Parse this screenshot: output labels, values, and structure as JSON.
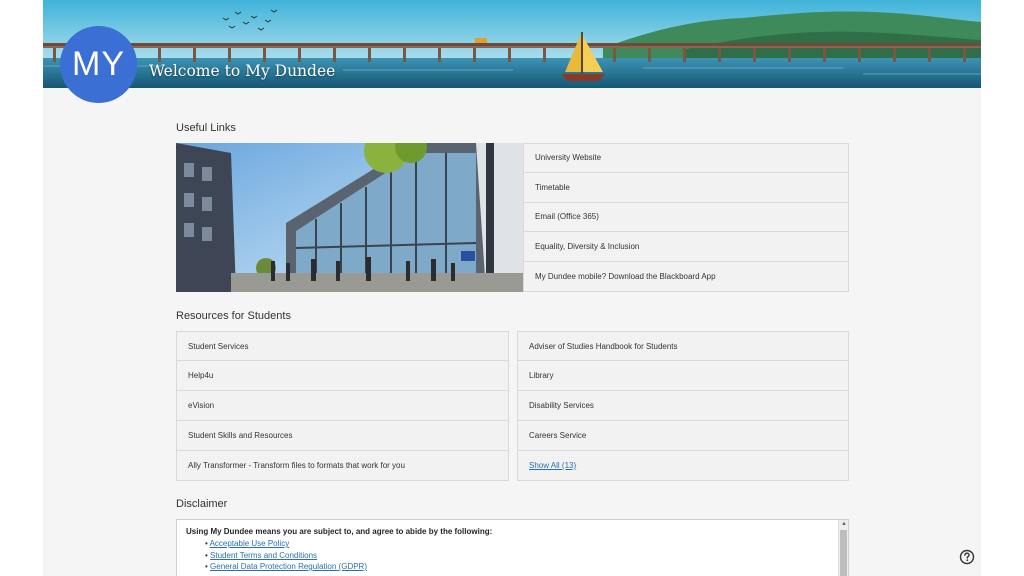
{
  "header": {
    "logo_text": "MY",
    "title": "Welcome to My Dundee"
  },
  "useful_links": {
    "heading": "Useful Links",
    "items": [
      {
        "label": "University Website"
      },
      {
        "label": "Timetable"
      },
      {
        "label": "Email (Office 365)"
      },
      {
        "label": "Equality, Diversity & Inclusion"
      },
      {
        "label": "My Dundee mobile? Download the Blackboard App"
      }
    ]
  },
  "resources": {
    "heading": "Resources for Students",
    "left": [
      {
        "label": "Student Services"
      },
      {
        "label": "Help4u"
      },
      {
        "label": "eVision"
      },
      {
        "label": "Student Skills and Resources"
      },
      {
        "label": "Ally Transformer - Transform files to formats that work for you"
      }
    ],
    "right": [
      {
        "label": "Adviser of Studies Handbook for Students"
      },
      {
        "label": "Library"
      },
      {
        "label": "Disability Services"
      },
      {
        "label": "Careers Service"
      }
    ],
    "show_all": "Show All (13)"
  },
  "disclaimer": {
    "heading": "Disclaimer",
    "lead": "Using My Dundee means you are subject to, and agree to abide by the following:",
    "links": [
      {
        "label": "Acceptable Use Policy"
      },
      {
        "label": "Student Terms and Conditions"
      },
      {
        "label": "General Data Protection Regulation (GDPR)"
      }
    ]
  },
  "icons": {
    "help": "help-circle-icon",
    "logo": "my-dundee-logo",
    "banner": "tay-bridge-illustration"
  },
  "colors": {
    "logo_blue": "#3b6fd4",
    "link_blue": "#2b6fb3",
    "page_bg": "#f5f5f5"
  }
}
